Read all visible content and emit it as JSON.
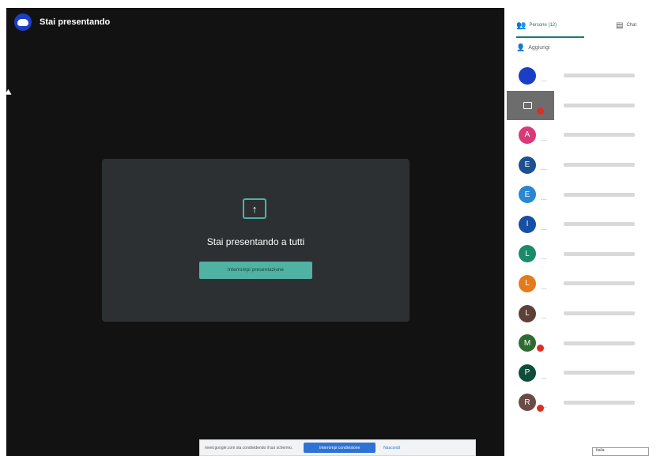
{
  "topbar": {
    "title": "Stai presentando"
  },
  "present_card": {
    "message": "Stai presentando a tutti",
    "stop_label": "Interrompi presentazione"
  },
  "sharebar": {
    "text": "meet.google.com sta condividendo il tuo schermo.",
    "stop_label": "Interrompi condivisione",
    "hide_label": "Nascondi"
  },
  "panel": {
    "tabs": [
      {
        "label": "Persone (12)",
        "icon": "people-icon"
      },
      {
        "label": "Chat",
        "icon": "chat-icon"
      }
    ],
    "add_label": "Aggiungi",
    "participants": [
      {
        "initial": "",
        "color": "#1a3fc4",
        "type": "self-avatar",
        "badge": false
      },
      {
        "initial": "",
        "color": "#6d6d6d",
        "type": "screen",
        "badge": true
      },
      {
        "initial": "A",
        "color": "#d83a78",
        "type": "avatar",
        "badge": false
      },
      {
        "initial": "E",
        "color": "#1d4f91",
        "type": "avatar",
        "badge": false
      },
      {
        "initial": "E",
        "color": "#2a86d1",
        "type": "avatar",
        "badge": false
      },
      {
        "initial": "I",
        "color": "#174ea6",
        "type": "avatar",
        "badge": false
      },
      {
        "initial": "L",
        "color": "#1b8a68",
        "type": "avatar",
        "badge": false
      },
      {
        "initial": "L",
        "color": "#e37b1c",
        "type": "avatar",
        "badge": false
      },
      {
        "initial": "L",
        "color": "#5d4037",
        "type": "avatar",
        "badge": false
      },
      {
        "initial": "M",
        "color": "#2e6b30",
        "type": "avatar",
        "badge": true
      },
      {
        "initial": "P",
        "color": "#0f4d3a",
        "type": "avatar",
        "badge": false
      },
      {
        "initial": "R",
        "color": "#6b4b45",
        "type": "avatar",
        "badge": true
      }
    ]
  },
  "footer_select": {
    "value": "Italia"
  },
  "colors": {
    "accent": "#1a7a6a",
    "present_button": "#4fb2a3",
    "stage_bg": "#121212"
  }
}
